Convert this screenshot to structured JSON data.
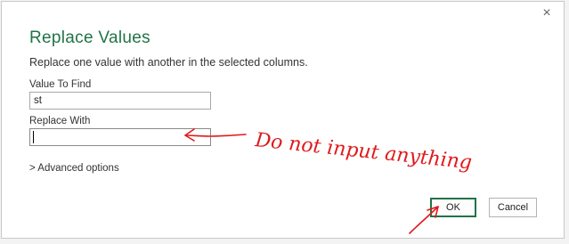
{
  "dialog": {
    "close_glyph": "×",
    "title": "Replace Values",
    "subtitle": "Replace one value with another in the selected columns.",
    "find": {
      "label": "Value To Find",
      "value": "st"
    },
    "replace": {
      "label": "Replace With",
      "value": ""
    },
    "advanced_label": "> Advanced options",
    "ok_label": "OK",
    "cancel_label": "Cancel"
  },
  "annotation": {
    "text": "Do not input anything",
    "color": "#e0191b"
  },
  "theme": {
    "accent": "#217346"
  }
}
